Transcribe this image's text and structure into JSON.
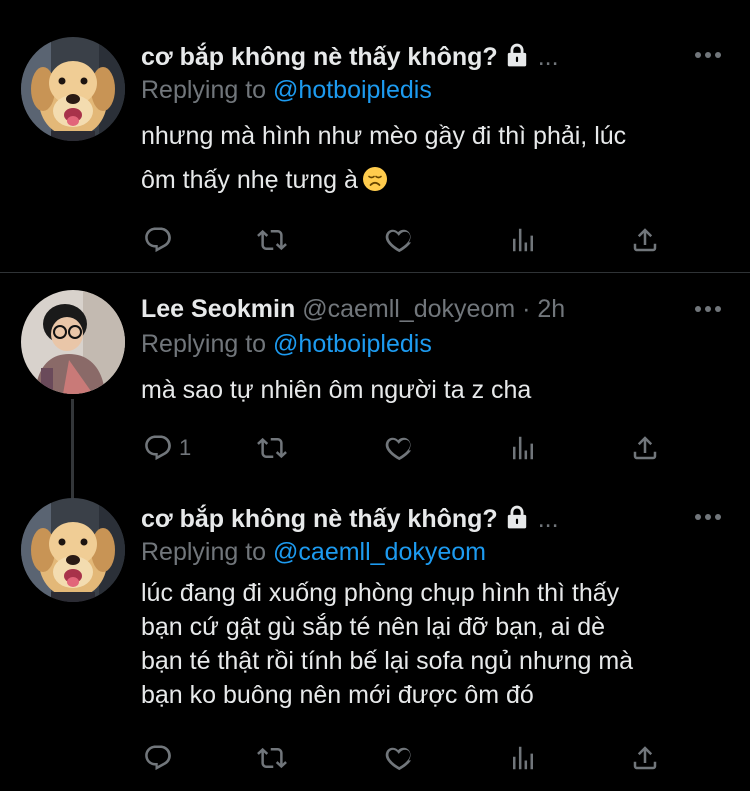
{
  "tweets": [
    {
      "display_name": "cơ bắp không nè thấy không?",
      "handle": "",
      "time": "",
      "protected": true,
      "avatar": "golden-retriever-puppy",
      "replying_label": "Replying to",
      "replying_to": "@hotboipledis",
      "text_lines": [
        "nhưng mà hình như mèo gầy đi thì phải, lúc",
        "ôm thấy nhẹ tưng à"
      ],
      "emoji": "disappointed-face",
      "reply_count": ""
    },
    {
      "display_name": "Lee Seokmin",
      "handle": "@caemll_dokyeom",
      "time": "2h",
      "protected": false,
      "avatar": "person-with-glasses",
      "replying_label": "Replying to",
      "replying_to": "@hotboipledis",
      "text_lines": [
        "mà sao tự nhiên ôm người ta z cha"
      ],
      "reply_count": "1"
    },
    {
      "display_name": "cơ bắp không nè thấy không?",
      "handle": "",
      "time": "",
      "protected": true,
      "avatar": "golden-retriever-puppy",
      "replying_label": "Replying to",
      "replying_to": "@caemll_dokyeom",
      "text_lines": [
        "lúc đang đi xuống phòng chụp hình thì thấy",
        "bạn cứ gật gù sắp té nên lại đỡ bạn, ai dè",
        "bạn té thật rồi tính bế lại sofa ngủ nhưng mà",
        "bạn ko buông nên mới được ôm đó"
      ],
      "reply_count": ""
    }
  ],
  "header_sep": "·",
  "ellipsis": "...",
  "colors": {
    "background": "#000000",
    "text": "#e7e9ea",
    "secondary": "#71767b",
    "link": "#1d9bf0",
    "divider": "#2f3336"
  },
  "icons": [
    "reply-icon",
    "retweet-icon",
    "like-icon",
    "analytics-icon",
    "share-icon",
    "more-icon",
    "lock-icon"
  ]
}
